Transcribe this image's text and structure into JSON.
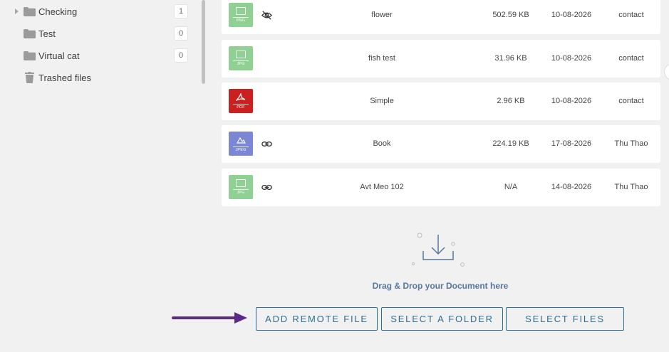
{
  "sidebar": {
    "items": [
      {
        "label": "Checking",
        "count": "1",
        "expandable": true
      },
      {
        "label": "Test",
        "count": "0",
        "expandable": false
      },
      {
        "label": "Virtual cat",
        "count": "0",
        "expandable": false
      }
    ],
    "trash_label": "Trashed files"
  },
  "files": [
    {
      "name": "flower",
      "size": "502.59 KB",
      "date": "10-08-2026",
      "author": "contact",
      "ext": "PNG",
      "thumb_color": "#8fd193",
      "flag": "hidden-icon"
    },
    {
      "name": "fish test",
      "size": "31.96 KB",
      "date": "10-08-2026",
      "author": "contact",
      "ext": "JPG",
      "thumb_color": "#8fd193",
      "flag": ""
    },
    {
      "name": "Simple",
      "size": "2.96 KB",
      "date": "10-08-2026",
      "author": "contact",
      "ext": "PDF",
      "thumb_color": "#cc1f1f",
      "flag": ""
    },
    {
      "name": "Book",
      "size": "224.19 KB",
      "date": "17-08-2026",
      "author": "Thu Thao",
      "ext": "JPEG",
      "thumb_color": "#7b86d6",
      "flag": "link-icon"
    },
    {
      "name": "Avt Meo 102",
      "size": "N/A",
      "date": "14-08-2026",
      "author": "Thu Thao",
      "ext": "JPG",
      "thumb_color": "#8fd193",
      "flag": "link-icon"
    }
  ],
  "dropzone": {
    "text": "Drag & Drop your Document here",
    "icon": "download-tray-icon"
  },
  "actions": {
    "add_remote": "ADD REMOTE FILE",
    "select_folder": "SELECT A FOLDER",
    "select_files": "SELECT FILES"
  },
  "colors": {
    "accent": "#2d6f92",
    "annotation_arrow": "#5b2a86"
  }
}
